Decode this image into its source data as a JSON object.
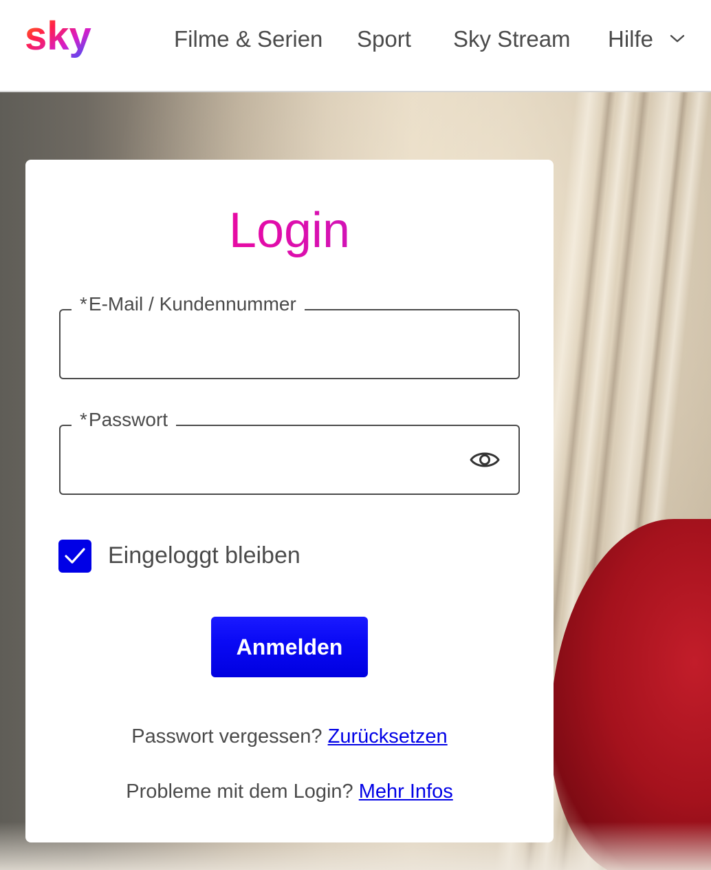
{
  "header": {
    "logo_text": "sky",
    "nav": [
      {
        "label": "Filme & Serien"
      },
      {
        "label": "Sport"
      },
      {
        "label": "Sky Stream"
      },
      {
        "label": "Hilfe"
      }
    ]
  },
  "login": {
    "title": "Login",
    "email_field": {
      "required_marker": "*",
      "label": "E-Mail / Kundennummer",
      "value": ""
    },
    "password_field": {
      "required_marker": "*",
      "label": "Passwort",
      "value": ""
    },
    "remember_me": {
      "label": "Eingeloggt bleiben",
      "checked": true
    },
    "submit_label": "Anmelden",
    "forgot": {
      "text": "Passwort vergessen?",
      "link": "Zurücksetzen"
    },
    "problems": {
      "text": "Probleme mit dem Login?",
      "link": "Mehr Infos"
    }
  },
  "colors": {
    "accent_blue": "#0000e6",
    "title_gradient_start": "#ff0a7a",
    "title_gradient_end": "#a52ad8",
    "text_gray": "#4a4a4a"
  },
  "icons": [
    "sky-logo",
    "chevron-down-icon",
    "eye-icon",
    "checkmark-icon"
  ]
}
